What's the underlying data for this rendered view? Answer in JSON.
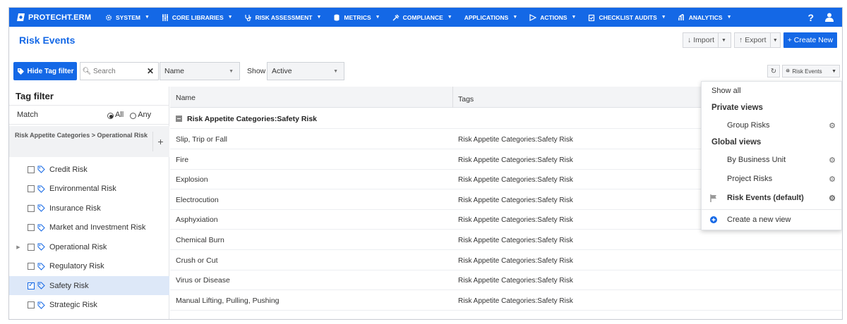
{
  "nav": {
    "brand": "PROTECHT.ERM",
    "items": [
      {
        "label": "SYSTEM",
        "icon": "gear-icon"
      },
      {
        "label": "CORE LIBRARIES",
        "icon": "libraries-icon"
      },
      {
        "label": "RISK ASSESSMENT",
        "icon": "stethoscope-icon"
      },
      {
        "label": "METRICS",
        "icon": "metrics-icon"
      },
      {
        "label": "COMPLIANCE",
        "icon": "compliance-icon"
      },
      {
        "label": "APPLICATIONS",
        "icon": ""
      },
      {
        "label": "ACTIONS",
        "icon": "play-icon"
      },
      {
        "label": "CHECKLIST AUDITS",
        "icon": "clipboard-icon"
      },
      {
        "label": "ANALYTICS",
        "icon": "chart-icon"
      }
    ],
    "help": "?",
    "user_icon": "user-icon"
  },
  "page": {
    "title": "Risk Events",
    "import_label": "Import",
    "export_label": "Export",
    "create_label": "+ Create New"
  },
  "toolbar": {
    "hide_tag_label": "Hide Tag filter",
    "search_placeholder": "Search",
    "field_select": "Name",
    "show_label": "Show",
    "show_select": "Active",
    "view_label": "Risk Events"
  },
  "tag_filter": {
    "title": "Tag filter",
    "match_label": "Match",
    "all_label": "All",
    "any_label": "Any",
    "breadcrumb": "Risk Appetite Categories > Operational Risk",
    "items": [
      {
        "label": "Credit Risk",
        "checked": false,
        "expandable": false
      },
      {
        "label": "Environmental Risk",
        "checked": false,
        "expandable": false
      },
      {
        "label": "Insurance Risk",
        "checked": false,
        "expandable": false
      },
      {
        "label": "Market and Investment Risk",
        "checked": false,
        "expandable": false
      },
      {
        "label": "Operational Risk",
        "checked": false,
        "expandable": true
      },
      {
        "label": "Regulatory Risk",
        "checked": false,
        "expandable": false
      },
      {
        "label": "Safety Risk",
        "checked": true,
        "expandable": false
      },
      {
        "label": "Strategic Risk",
        "checked": false,
        "expandable": false
      }
    ]
  },
  "table": {
    "columns": [
      "Name",
      "Tags"
    ],
    "group": "Risk Appetite Categories:Safety Risk",
    "rows": [
      {
        "name": "Slip, Trip or Fall",
        "tags": "Risk Appetite Categories:Safety Risk"
      },
      {
        "name": "Fire",
        "tags": "Risk Appetite Categories:Safety Risk"
      },
      {
        "name": "Explosion",
        "tags": "Risk Appetite Categories:Safety Risk"
      },
      {
        "name": "Electrocution",
        "tags": "Risk Appetite Categories:Safety Risk"
      },
      {
        "name": "Asphyxiation",
        "tags": "Risk Appetite Categories:Safety Risk"
      },
      {
        "name": "Chemical Burn",
        "tags": "Risk Appetite Categories:Safety Risk"
      },
      {
        "name": "Crush or Cut",
        "tags": "Risk Appetite Categories:Safety Risk"
      },
      {
        "name": "Virus or Disease",
        "tags": "Risk Appetite Categories:Safety Risk"
      },
      {
        "name": "Manual Lifting, Pulling, Pushing",
        "tags": "Risk Appetite Categories:Safety Risk"
      }
    ]
  },
  "views_menu": {
    "show_all": "Show all",
    "private_header": "Private views",
    "private": [
      "Group Risks"
    ],
    "global_header": "Global views",
    "global": [
      "By Business Unit",
      "Project Risks"
    ],
    "default_view": "Risk Events (default)",
    "create_view": "Create a new view"
  },
  "colors": {
    "accent": "#1468e6"
  }
}
